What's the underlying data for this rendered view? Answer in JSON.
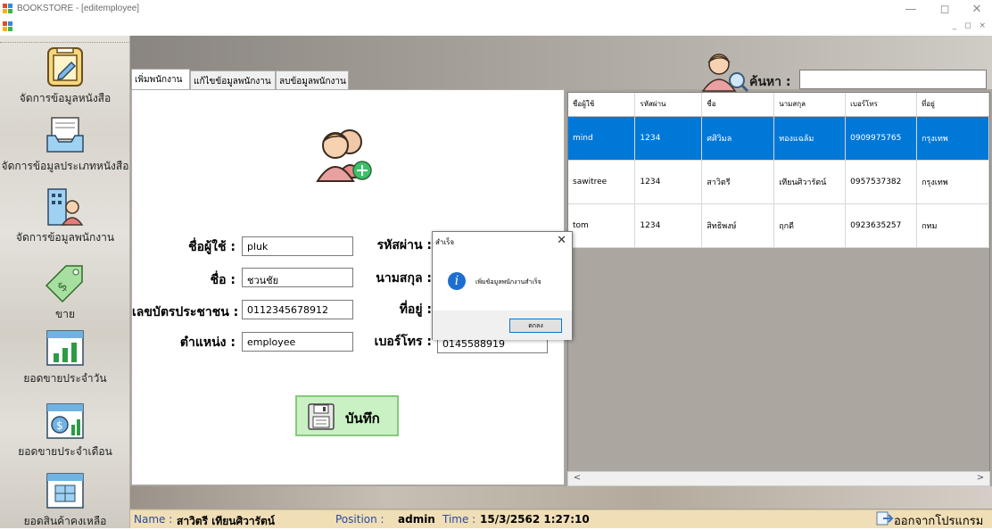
{
  "window": {
    "title": "BOOKSTORE - [editemployee]",
    "minimize": "—",
    "maximize": "◻",
    "close": "✕",
    "mdi_controls": "_ ◻ ×"
  },
  "sidebar": {
    "items": [
      {
        "label": "จัดการข้อมูลหนังสือ",
        "icon": "book-edit-icon"
      },
      {
        "label": "จัดการข้อมูลประเภทหนังสือ",
        "icon": "inbox-tray-icon"
      },
      {
        "label": "จัดการข้อมูลพนักงาน",
        "icon": "employee-building-icon"
      },
      {
        "label": "ขาย",
        "icon": "price-tag-icon"
      },
      {
        "label": "ยอดขายประจำวัน",
        "icon": "daily-chart-icon"
      },
      {
        "label": "ยอดขายประจำเดือน",
        "icon": "monthly-money-icon"
      },
      {
        "label": "ยอดสินค้าคงเหลือ",
        "icon": "inventory-calendar-icon"
      }
    ]
  },
  "tabs": [
    {
      "label": "เพิ่มพนักงาน",
      "active": true
    },
    {
      "label": "แก้ไขข้อมูลพนักงาน",
      "active": false
    },
    {
      "label": "ลบข้อมูลพนักงาน",
      "active": false
    }
  ],
  "form": {
    "username_label": "ชื่อผู้ใช้ :",
    "username_value": "pluk",
    "password_label": "รหัสผ่าน :",
    "firstname_label": "ชื่อ :",
    "firstname_value": "ชวนชัย",
    "lastname_label": "นามสกุล :",
    "idcard_label": "เลขบัตรประชาชน :",
    "idcard_value": "0112345678912",
    "address_label": "ที่อยู่ :",
    "position_label": "ตำแหน่ง :",
    "position_value": "employee",
    "phone_label": "เบอร์โทร :",
    "phone_value": "0145588919",
    "save_label": "บันทึก"
  },
  "search": {
    "label": "ค้นหา :",
    "value": ""
  },
  "grid": {
    "columns": [
      "ชื่อผู้ใช้",
      "รหัสผ่าน",
      "ชื่อ",
      "นามสกุล",
      "เบอร์โทร",
      "ที่อยู่"
    ],
    "rows": [
      [
        "mind",
        "1234",
        "ศศิวิมล",
        "ทองแฉล้ม",
        "0909975765",
        "กรุงเทพ"
      ],
      [
        "sawitree",
        "1234",
        "สาวิตรี",
        "เทียนศิวารัตน์",
        "0957537382",
        "กรุงเทพ"
      ],
      [
        "tom",
        "1234",
        "สิทธิพงษ์",
        "ฤกดี",
        "0923635257",
        "กทม"
      ]
    ],
    "selected_row": 0,
    "scroll_left": "<",
    "scroll_right": ">"
  },
  "status": {
    "name_label": "Name :",
    "name_value": "สาวิตรี เทียนศิวารัตน์",
    "position_label": "Position :",
    "position_value": "admin",
    "time_label": "Time :",
    "time_value": "15/3/2562 1:27:10",
    "exit_label": "ออกจากโปรแกรม"
  },
  "dialog": {
    "title": "สำเร็จ",
    "close": "✕",
    "message": "เพิ่มข้อมูลพนักงานสำเร็จ",
    "ok_label": "ตกลง",
    "icon": "i"
  },
  "colors": {
    "selection": "#0078d7",
    "save_button": "#c9f1c3",
    "status_bar": "#f0deb6"
  }
}
